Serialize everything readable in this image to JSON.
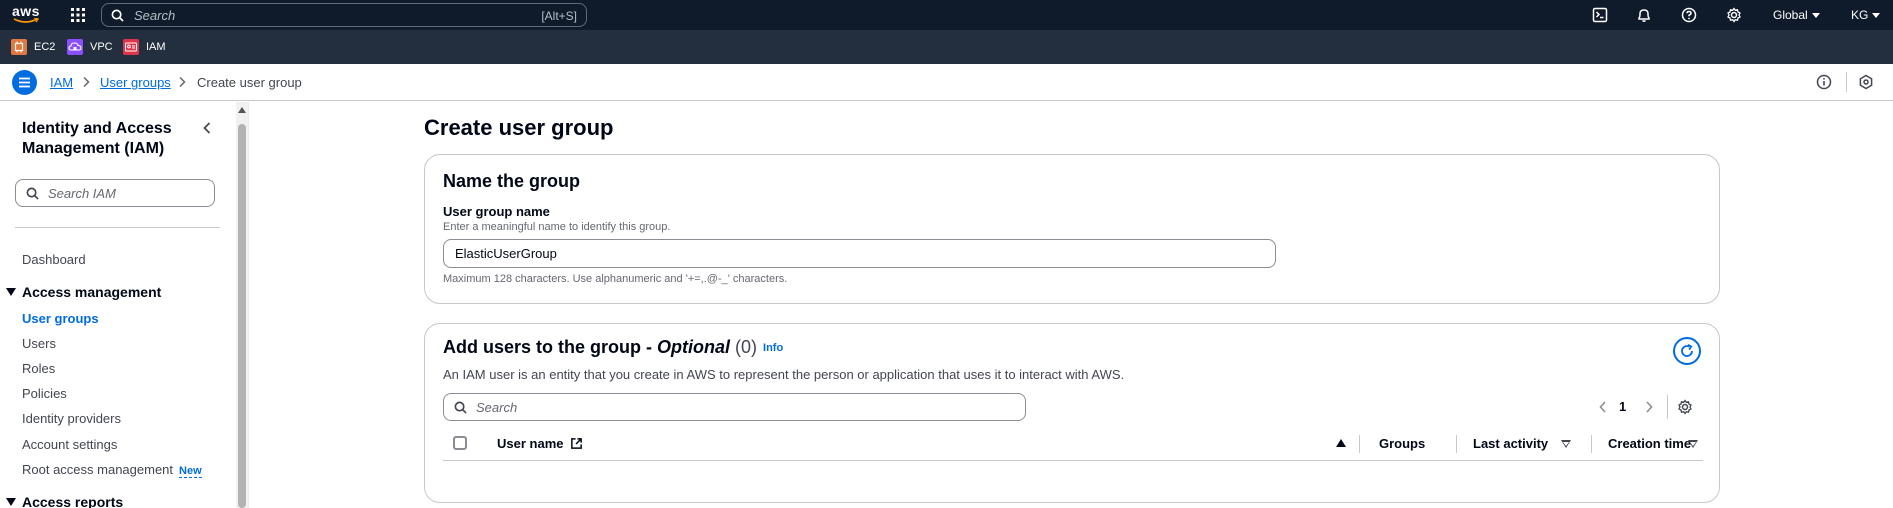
{
  "topnav": {
    "logo": "aws",
    "search_placeholder": "Search",
    "search_shortcut": "[Alt+S]",
    "region": "Global",
    "account": "KG",
    "icons": [
      "services-grid-icon",
      "cloudshell-icon",
      "bell-icon",
      "help-icon",
      "settings-icon"
    ]
  },
  "favorites": [
    {
      "label": "EC2",
      "color": "#e07941",
      "icon": "ec2-icon"
    },
    {
      "label": "VPC",
      "color": "#8c4fff",
      "icon": "vpc-icon"
    },
    {
      "label": "IAM",
      "color": "#dd344c",
      "icon": "iam-icon"
    }
  ],
  "breadcrumb": {
    "items": [
      "IAM",
      "User groups"
    ],
    "current": "Create user group"
  },
  "sidebar": {
    "title": "Identity and Access Management (IAM)",
    "search_placeholder": "Search IAM",
    "dashboard": "Dashboard",
    "section_access_management": "Access management",
    "items": [
      "User groups",
      "Users",
      "Roles",
      "Policies",
      "Identity providers",
      "Account settings",
      "Root access management"
    ],
    "new_badge": "New",
    "section_access_reports": "Access reports"
  },
  "main": {
    "page_title": "Create user group",
    "name_card": {
      "heading": "Name the group",
      "label": "User group name",
      "description": "Enter a meaningful name to identify this group.",
      "value": "ElasticUserGroup",
      "constraint": "Maximum 128 characters. Use alphanumeric and '+=,.@-_' characters."
    },
    "users_card": {
      "heading_prefix": "Add users to the group - ",
      "heading_optional": "Optional",
      "count": "(0)",
      "info": "Info",
      "description": "An IAM user is an entity that you create in AWS to represent the person or application that uses it to interact with AWS.",
      "search_placeholder": "Search",
      "page": "1",
      "columns": [
        "User name",
        "Groups",
        "Last activity",
        "Creation time"
      ]
    }
  },
  "colors": {
    "nav_bg": "#0f1b2a",
    "fav_bg": "#232f3e",
    "link": "#006ce0"
  }
}
